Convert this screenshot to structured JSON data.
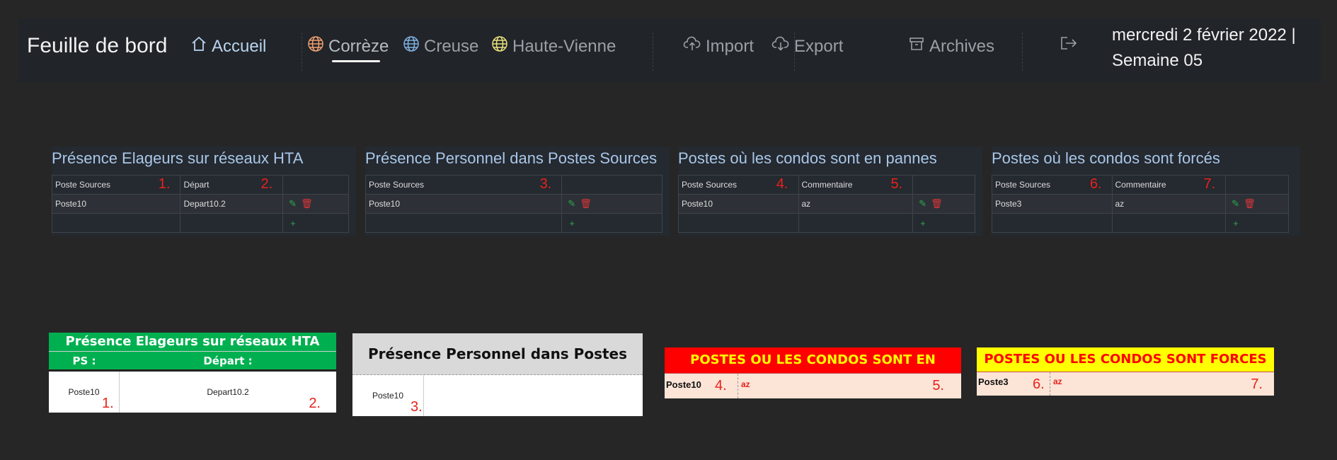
{
  "nav": {
    "brand": "Feuille de bord",
    "home": "Accueil",
    "regions": [
      "Corrèze",
      "Creuse",
      "Haute-Vienne"
    ],
    "import": "Import",
    "export": "Export",
    "archives": "Archives",
    "date_line1": "mercredi 2 février 2022 |",
    "date_line2": "Semaine 05"
  },
  "icons": {
    "home": "home-icon",
    "globe": "globe-icon",
    "import": "cloud-upload-icon",
    "export": "cloud-download-icon",
    "archive": "archive-icon",
    "logout": "logout-icon",
    "edit": "pencil-icon",
    "delete": "trash-icon",
    "add": "plus-icon"
  },
  "colors": {
    "globe_correze": "#f0a070",
    "globe_creuse": "#7fb0e0",
    "globe_haute_vienne": "#e8e07a",
    "excel_green": "#00b050",
    "excel_red": "#ff0000",
    "excel_yellow": "#ffff00",
    "marker_red": "#e8221c"
  },
  "panels": [
    {
      "title": "Présence Elageurs sur réseaux HTA",
      "headers": [
        "Poste Sources",
        "Départ"
      ],
      "markers": [
        "1.",
        "2."
      ],
      "row": [
        "Poste10",
        "Depart10.2"
      ]
    },
    {
      "title": "Présence Personnel dans Postes Sources",
      "headers": [
        "Poste Sources"
      ],
      "markers": [
        "3."
      ],
      "row": [
        "Poste10"
      ]
    },
    {
      "title": "Postes où les condos sont en pannes",
      "headers": [
        "Poste Sources",
        "Commentaire"
      ],
      "markers": [
        "4.",
        "5."
      ],
      "row": [
        "Poste10",
        "az"
      ]
    },
    {
      "title": "Postes où les condos sont forcés",
      "headers": [
        "Poste Sources",
        "Commentaire"
      ],
      "markers": [
        "6.",
        "7."
      ],
      "row": [
        "Poste3",
        "az"
      ]
    }
  ],
  "excel": {
    "elageurs": {
      "title": "Présence Elageurs sur réseaux HTA",
      "col1": "PS :",
      "col2": "Départ :",
      "val1": "Poste10",
      "val2": "Depart10.2",
      "m1": "1.",
      "m2": "2."
    },
    "personnel": {
      "title": "Présence Personnel dans Postes Sources",
      "val": "Poste10",
      "m": "3."
    },
    "pannes": {
      "title": "POSTES OU LES CONDOS SONT EN PANNES",
      "val1": "Poste10",
      "val2": "az",
      "m1": "4.",
      "m2": "5."
    },
    "forces": {
      "title": "POSTES OU LES CONDOS SONT FORCES",
      "val1": "Poste3",
      "val2": "az",
      "m1": "6.",
      "m2": "7."
    }
  }
}
